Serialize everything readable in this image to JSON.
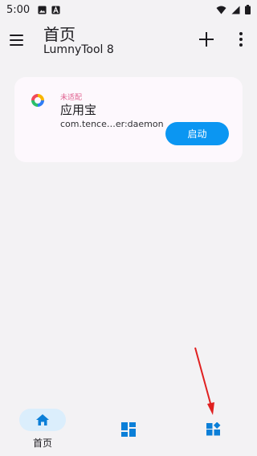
{
  "status_bar": {
    "time": "5:00",
    "left_icons": [
      "image-icon",
      "font-a-icon"
    ],
    "right_icons": [
      "wifi-icon",
      "signal-icon",
      "battery-icon"
    ]
  },
  "app_bar": {
    "title": "首页",
    "subtitle": "LumnyTool 8",
    "menu_icon": "hamburger-menu-icon",
    "add_icon": "plus-icon",
    "more_icon": "more-vertical-icon"
  },
  "app_card": {
    "status_tag": "未适配",
    "app_name": "应用宝",
    "package": "com.tence…er:daemon",
    "launch_label": "启动",
    "logo_icon": "yingyongbao-logo"
  },
  "bottom_nav": {
    "items": [
      {
        "label": "首页",
        "icon": "home-icon",
        "selected": true
      },
      {
        "label": "",
        "icon": "dashboard-icon",
        "selected": false
      },
      {
        "label": "",
        "icon": "extensions-icon",
        "selected": false
      }
    ]
  },
  "colors": {
    "background": "#f3f2f4",
    "card": "#fdf8fd",
    "accent": "#0b96f2",
    "status_tag": "#e0608f",
    "nav_pill": "#dbeefc",
    "annotation": "#e02020"
  }
}
